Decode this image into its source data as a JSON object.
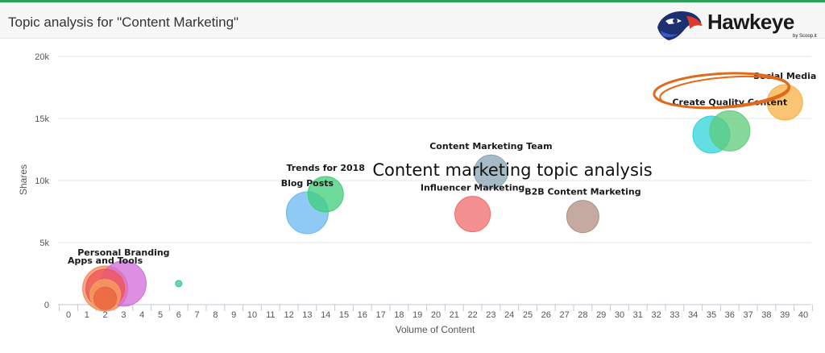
{
  "header": {
    "title": "Topic analysis for \"Content Marketing\"",
    "logo_word": "Hawkeye",
    "logo_sub": "by Scoop.it",
    "logo_icon": "hawk-head-icon",
    "accent": "#2e9e5b"
  },
  "chart_data": {
    "type": "bubble",
    "overlay_text": "Content marketing topic analysis",
    "xlabel": "Volume of Content",
    "ylabel": "Shares",
    "xlim": [
      0,
      40
    ],
    "ylim": [
      0,
      20000
    ],
    "x_ticks": [
      0,
      1,
      2,
      3,
      4,
      5,
      6,
      7,
      8,
      9,
      10,
      11,
      12,
      13,
      14,
      15,
      16,
      17,
      18,
      19,
      20,
      21,
      22,
      23,
      24,
      25,
      26,
      27,
      28,
      29,
      30,
      31,
      32,
      33,
      34,
      35,
      36,
      37,
      38,
      39,
      40
    ],
    "y_ticks": [
      0,
      5000,
      10000,
      15000,
      20000
    ],
    "y_tick_labels": [
      "0",
      "5k",
      "10k",
      "15k",
      "20k"
    ],
    "grid": "horizontal",
    "highlight": {
      "label": "Create Quality Content",
      "color": "#e06a1a"
    },
    "points": [
      {
        "label": "",
        "x": 2,
        "y": 1300,
        "size": 28,
        "color": "#f08a5d"
      },
      {
        "label": "Personal Branding",
        "x": 3,
        "y": 1700,
        "size": 28,
        "color": "#d16adb"
      },
      {
        "label": "Apps and Tools",
        "x": 2,
        "y": 1300,
        "size": 24,
        "color": "#ef5454"
      },
      {
        "label": "",
        "x": 2,
        "y": 800,
        "size": 19,
        "color": "#f5a35c"
      },
      {
        "label": "",
        "x": 2,
        "y": 500,
        "size": 14,
        "color": "#e8623c"
      },
      {
        "label": "",
        "x": 6,
        "y": 1700,
        "size": 4,
        "color": "#2ecc8a"
      },
      {
        "label": "Blog Posts",
        "x": 13,
        "y": 7400,
        "size": 26,
        "color": "#6ab8f0"
      },
      {
        "label": "Trends for 2018",
        "x": 14,
        "y": 8900,
        "size": 22,
        "color": "#3ecf7a"
      },
      {
        "label": "Influencer Marketing",
        "x": 22,
        "y": 7300,
        "size": 22,
        "color": "#f26b6b"
      },
      {
        "label": "Content Marketing Team",
        "x": 23,
        "y": 10700,
        "size": 21,
        "color": "#8aa4b4"
      },
      {
        "label": "B2B Content Marketing",
        "x": 28,
        "y": 7100,
        "size": 20,
        "color": "#b08d82"
      },
      {
        "label": "",
        "x": 35,
        "y": 13700,
        "size": 23,
        "color": "#2fd3d8"
      },
      {
        "label": "Create Quality Content",
        "x": 36,
        "y": 14000,
        "size": 25,
        "color": "#5ecb7a"
      },
      {
        "label": "Social Media",
        "x": 39,
        "y": 16300,
        "size": 22,
        "color": "#f7b044"
      }
    ]
  }
}
